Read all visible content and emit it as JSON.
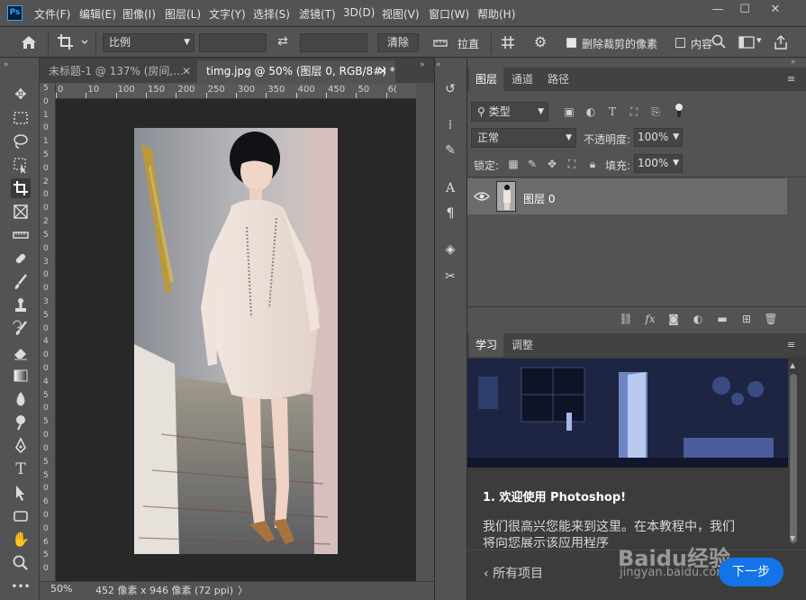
{
  "menubar": {
    "app_logo": "Ps",
    "items": [
      "文件(F)",
      "编辑(E)",
      "图像(I)",
      "图层(L)",
      "文字(Y)",
      "选择(S)",
      "滤镜(T)",
      "3D(D)",
      "视图(V)",
      "窗口(W)",
      "帮助(H)"
    ],
    "window_controls": {
      "minimize": "—",
      "restore": "☐",
      "close": "✕"
    }
  },
  "options": {
    "ratio_select": "比例",
    "ratio_width": "",
    "ratio_height": "",
    "swap_icon": "⇄",
    "clear_button": "清除",
    "straighten_label": "拉直",
    "delete_cropped_label": "删除裁剪的像素",
    "delete_cropped_checked": true,
    "content_aware_label": "内容",
    "content_aware_checked": false
  },
  "documents": {
    "tabs": [
      {
        "label": "未标题-1 @ 137% (房间,...",
        "active": false
      },
      {
        "label": "timg.jpg @ 50% (图层 0, RGB/8#) *",
        "active": true
      }
    ],
    "ruler_top_ticks": [
      "0",
      "10",
      "100",
      "150",
      "200",
      "250",
      "300",
      "350",
      "400",
      "450",
      "50",
      "6("
    ],
    "ruler_left_ticks": [
      "5",
      "0",
      "1",
      "0",
      "1",
      "5",
      "0",
      "2",
      "0",
      "0",
      "2",
      "5",
      "0",
      "3",
      "0",
      "0",
      "3",
      "5",
      "0",
      "4",
      "0",
      "0",
      "4",
      "5",
      "0",
      "5",
      "0",
      "0",
      "5",
      "5",
      "0",
      "6",
      "0",
      "0",
      "6",
      "5",
      "0"
    ]
  },
  "status": {
    "zoom": "50%",
    "doc_info": "452 像素 x 946 像素 (72 ppi)",
    "arrow": "〉"
  },
  "layers_panel": {
    "tabs": [
      "图层",
      "通道",
      "路径"
    ],
    "active_tab": "图层",
    "filter_label": "类型",
    "blend_mode": "正常",
    "opacity_label": "不透明度:",
    "opacity_value": "100%",
    "lock_label": "锁定:",
    "fill_label": "填充:",
    "fill_value": "100%",
    "layers": [
      {
        "name": "图层 0",
        "visible": true,
        "selected": true
      }
    ]
  },
  "learn_panel": {
    "tabs": [
      "学习",
      "调整"
    ],
    "active_tab": "学习",
    "heading_num": "1.",
    "heading_text": "欢迎使用 Photoshop!",
    "body_line1": "我们很高兴您能来到这里。在本教程中，我们",
    "body_line2": "将向您展示该应用程序",
    "back_label": "所有项目",
    "next_button": "下一步",
    "watermark": "Baidu经验",
    "watermark_url": "jingyan.baidu.com"
  },
  "colors": {
    "accent": "#31a8ff",
    "panel_bg": "#535353",
    "canvas_bg": "#282828",
    "next_button_bg": "#1473e6"
  }
}
